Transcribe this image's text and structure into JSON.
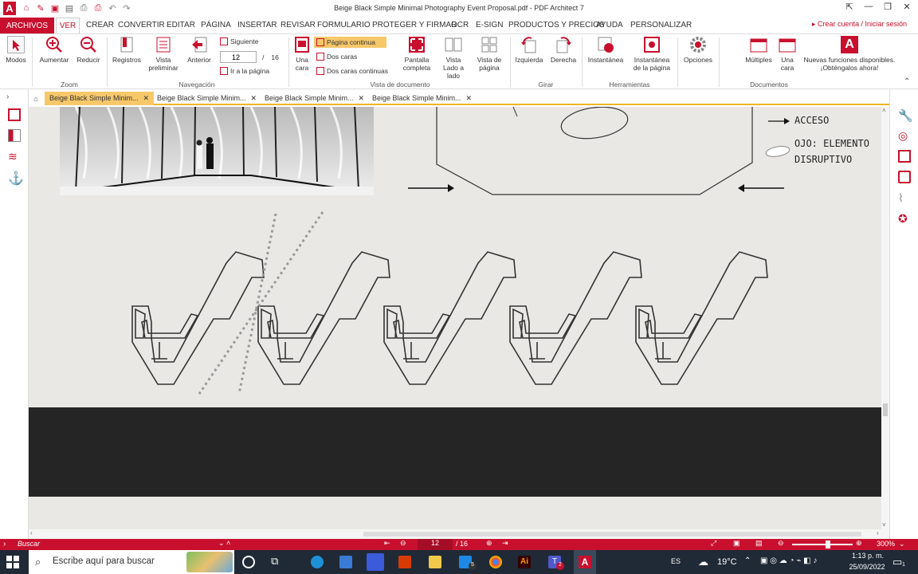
{
  "window": {
    "title": "Beige Black Simple Minimal Photography Event Proposal.pdf   -   PDF Architect 7"
  },
  "menu": {
    "archivos": "ARCHIVOS",
    "items": [
      "VER",
      "CREAR",
      "CONVERTIR",
      "EDITAR",
      "PÁGINA",
      "INSERTAR",
      "REVISAR",
      "FORMULARIO",
      "PROTEGER Y FIRMAR",
      "OCR",
      "E-SIGN",
      "PRODUCTOS Y PRECIOS",
      "AYUDA",
      "PERSONALIZAR"
    ],
    "signin": "▸ Crear cuenta / Iniciar sesión"
  },
  "ribbon": {
    "modos": "Modos",
    "aumentar": "Aumentar",
    "reducir": "Reducir",
    "zoom_group": "Zoom",
    "registros": "Registros",
    "vista_preliminar": "Vista preliminar",
    "anterior": "Anterior",
    "siguiente": "Siguiente",
    "page_current": "12",
    "page_sep": "/",
    "page_total": "16",
    "ir_pagina": "Ir a la página",
    "nav_group": "Navegación",
    "una_cara": "Una cara",
    "pagina_continua": "Página continua",
    "dos_caras": "Dos caras",
    "dos_caras_continuas": "Dos caras continuas",
    "pantalla_completa": "Pantalla completa",
    "vista_lado": "Vista Lado a lado",
    "vista_pagina": "Vista de página",
    "vista_group": "Vista de documento",
    "izquierda": "Izquierda",
    "derecha": "Derecha",
    "girar_group": "Girar",
    "instantanea": "Instantánea",
    "instantanea_pagina": "Instantánea de la página",
    "herr_group": "Herramientas",
    "opciones": "Opciones",
    "multiples": "Múltiples",
    "una_cara_doc": "Una cara",
    "nuevas": "Nuevas funciones disponibles. ¡Obténgalos ahora!",
    "docs_group": "Documentos"
  },
  "tabs": [
    {
      "label": "Beige Black Simple Minim..."
    },
    {
      "label": "Beige Black Simple Minim..."
    },
    {
      "label": "Beige Black Simple Minim..."
    },
    {
      "label": "Beige Black Simple Minim..."
    }
  ],
  "tab_close": "✕",
  "document": {
    "legend_acceso": "ACCESO",
    "legend_ojo": "OJO: ELEMENTO",
    "legend_disruptivo": "DISRUPTIVO"
  },
  "status": {
    "buscar": "Buscar",
    "page_current": "12",
    "page_total": "/ 16",
    "zoom": "300%"
  },
  "taskbar": {
    "search_placeholder": "Escribe aquí para buscar",
    "lang": "ES",
    "temp": "19°C",
    "time": "1:13 p. m.",
    "date": "25/09/2022",
    "mail_badge": "5",
    "teams_badge": "2",
    "notif_badge": "1"
  },
  "colors": {
    "accent": "#c8102e",
    "tab_active": "#f7c86a",
    "doc_bg": "#e9e8e4",
    "dark_band": "#252525"
  }
}
